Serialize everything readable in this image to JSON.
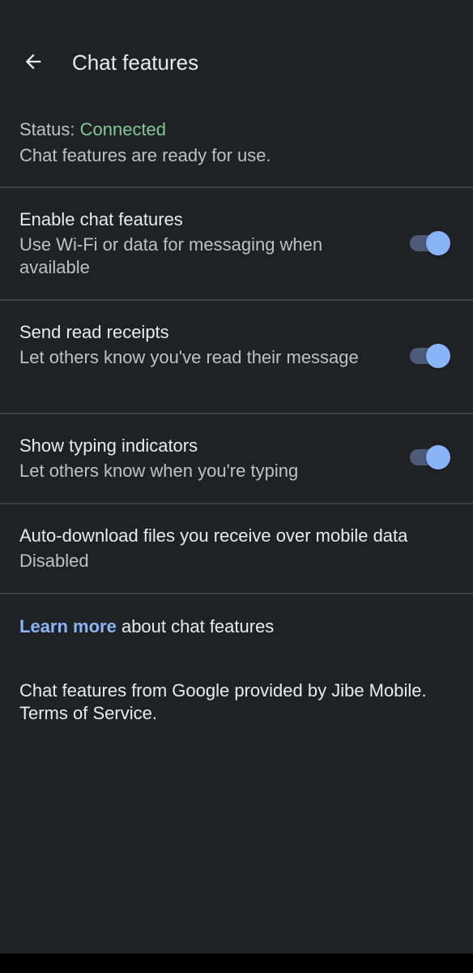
{
  "header": {
    "title": "Chat features",
    "back_icon": "arrow-back-icon"
  },
  "status": {
    "label": "Status:",
    "value": "Connected",
    "value_color": "#81c995",
    "description": "Chat features are ready for use."
  },
  "settings": [
    {
      "title": "Enable chat features",
      "summary": "Use Wi-Fi or data for messaging when available",
      "toggle_on": true
    },
    {
      "title": "Send read receipts",
      "summary": "Let others know you've read their message",
      "toggle_on": true
    },
    {
      "title": "Show typing indicators",
      "summary": "Let others know when you're typing",
      "toggle_on": true
    },
    {
      "title": "Auto-download files you receive over mobile data",
      "summary": "Disabled"
    }
  ],
  "learn_more": {
    "link_text": "Learn more",
    "rest_text": "about chat features"
  },
  "footer": {
    "text": "Chat features from Google provided by Jibe Mobile. Terms of Service."
  },
  "colors": {
    "background": "#202124",
    "accent": "#8ab4f8",
    "divider": "#3c4043"
  }
}
